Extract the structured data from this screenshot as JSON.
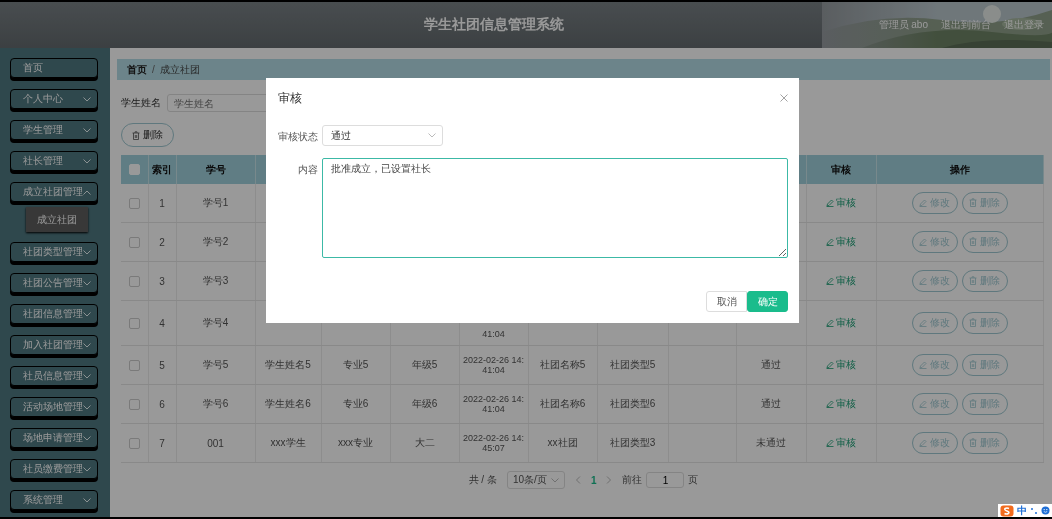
{
  "header": {
    "title": "学生社团信息管理系统",
    "user": "管理员 abo",
    "links": [
      "退出到前台",
      "退出登录"
    ]
  },
  "sidebar": {
    "items": [
      {
        "label": "首页",
        "kind": "link"
      },
      {
        "label": "个人中心",
        "kind": "menu",
        "expanded": false
      },
      {
        "label": "学生管理",
        "kind": "menu",
        "expanded": false
      },
      {
        "label": "社长管理",
        "kind": "menu",
        "expanded": false
      },
      {
        "label": "成立社团管理",
        "kind": "menu",
        "expanded": true,
        "children": [
          {
            "label": "成立社团",
            "selected": true
          }
        ]
      },
      {
        "label": "社团类型管理",
        "kind": "menu",
        "expanded": false
      },
      {
        "label": "社团公告管理",
        "kind": "menu",
        "expanded": false
      },
      {
        "label": "社团信息管理",
        "kind": "menu",
        "expanded": false
      },
      {
        "label": "加入社团管理",
        "kind": "menu",
        "expanded": false
      },
      {
        "label": "社员信息管理",
        "kind": "menu",
        "expanded": false
      },
      {
        "label": "活动场地管理",
        "kind": "menu",
        "expanded": false
      },
      {
        "label": "场地申请管理",
        "kind": "menu",
        "expanded": false
      },
      {
        "label": "社员缴费管理",
        "kind": "menu",
        "expanded": false
      },
      {
        "label": "系统管理",
        "kind": "menu",
        "expanded": false
      }
    ]
  },
  "breadcrumb": {
    "items": [
      "首页",
      "成立社团"
    ],
    "separator": "/"
  },
  "search": {
    "label": "学生姓名",
    "placeholder": "学生姓名"
  },
  "toolbar": {
    "delete": "删除"
  },
  "table": {
    "select_all": {
      "checked": false
    },
    "columns": [
      "索引",
      "学号",
      "审核",
      "操作"
    ],
    "rows": [
      {
        "checked": false,
        "index": "1",
        "student_no": "学号1",
        "review": "审核",
        "actions": [
          "修改",
          "删除"
        ]
      },
      {
        "checked": false,
        "index": "2",
        "student_no": "学号2",
        "review": "审核",
        "actions": [
          "修改",
          "删除"
        ]
      },
      {
        "checked": false,
        "index": "3",
        "student_no": "学号3",
        "review": "审核",
        "actions": [
          "修改",
          "删除"
        ]
      },
      {
        "checked": false,
        "cut_top": true,
        "index": "4",
        "student_no": "学号4",
        "time": "41:04",
        "review": "审核",
        "actions": [
          "修改",
          "删除"
        ]
      },
      {
        "checked": false,
        "index": "5",
        "student_no": "学号5",
        "name": "学生姓名5",
        "major": "专业5",
        "grade": "年级5",
        "time": "2022-02-26 14:41:04",
        "club": "社团名称5",
        "club_type": "社团类型5",
        "status": "通过",
        "review": "审核",
        "actions": [
          "修改",
          "删除"
        ]
      },
      {
        "checked": false,
        "index": "6",
        "student_no": "学号6",
        "name": "学生姓名6",
        "major": "专业6",
        "grade": "年级6",
        "time": "2022-02-26 14:41:04",
        "club": "社团名称6",
        "club_type": "社团类型6",
        "status": "通过",
        "review": "审核",
        "actions": [
          "修改",
          "删除"
        ]
      },
      {
        "checked": false,
        "index": "7",
        "student_no": "001",
        "name": "xxx学生",
        "major": "xxx专业",
        "grade": "大二",
        "time": "2022-02-26 14:45:07",
        "club": "xx社团",
        "club_type": "社团类型3",
        "status": "未通过",
        "review": "审核",
        "actions": [
          "修改",
          "删除"
        ]
      }
    ]
  },
  "pagination": {
    "total": "共 / 条",
    "page_size": "10条/页",
    "pages": [
      {
        "label": "1",
        "selected": true
      }
    ],
    "goto_label": "前往",
    "goto_value": "1",
    "goto_suffix": "页"
  },
  "dialog": {
    "title": "审核",
    "fields": [
      {
        "kind": "select",
        "label": "审核状态",
        "value": "通过"
      },
      {
        "kind": "textarea",
        "label": "内容",
        "value": "批准成立，已设置社长"
      }
    ],
    "buttons": [
      {
        "label": "取消",
        "kind": "secondary"
      },
      {
        "label": "确定",
        "kind": "primary"
      }
    ]
  },
  "ime": {
    "label": "中"
  }
}
